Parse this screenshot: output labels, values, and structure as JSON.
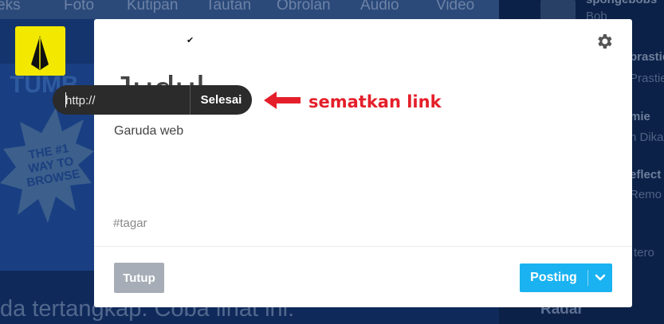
{
  "background": {
    "nav_tabs": [
      "eks",
      "Foto",
      "Kutipan",
      "Tautan",
      "Obrolan",
      "Audio",
      "Video"
    ],
    "banner_text": "TUMB",
    "badge_text": "THE #1 WAY TO BROWSE",
    "bottom_text": "da tertangkap. Coba lihat ini:",
    "sidebar": [
      {
        "name": "spongebobs",
        "sub": "Bob"
      },
      {
        "name": "brastie",
        "sub": "Prastie"
      },
      {
        "name": "mie",
        "sub": "n Dika"
      },
      {
        "name": "eflect",
        "sub": "Remo"
      }
    ],
    "sidebar_extra": "tero",
    "radar_label": "Radar"
  },
  "composer": {
    "blog_name": "",
    "check_glyph": "✔",
    "title": "Judul",
    "body": "Garuda web",
    "tags_placeholder": "#tagar",
    "close_label": "Tutup",
    "post_label": "Posting",
    "settings_icon": "gear-icon",
    "caret_icon": "chevron-down-icon"
  },
  "link_popover": {
    "placeholder": "http://",
    "done_label": "Selesai"
  },
  "annotation": {
    "text": "sematkan link",
    "color": "#e41f2a"
  },
  "colors": {
    "post_button": "#1ab2f0",
    "close_button": "#a6adb6",
    "avatar": "#f2e800"
  }
}
